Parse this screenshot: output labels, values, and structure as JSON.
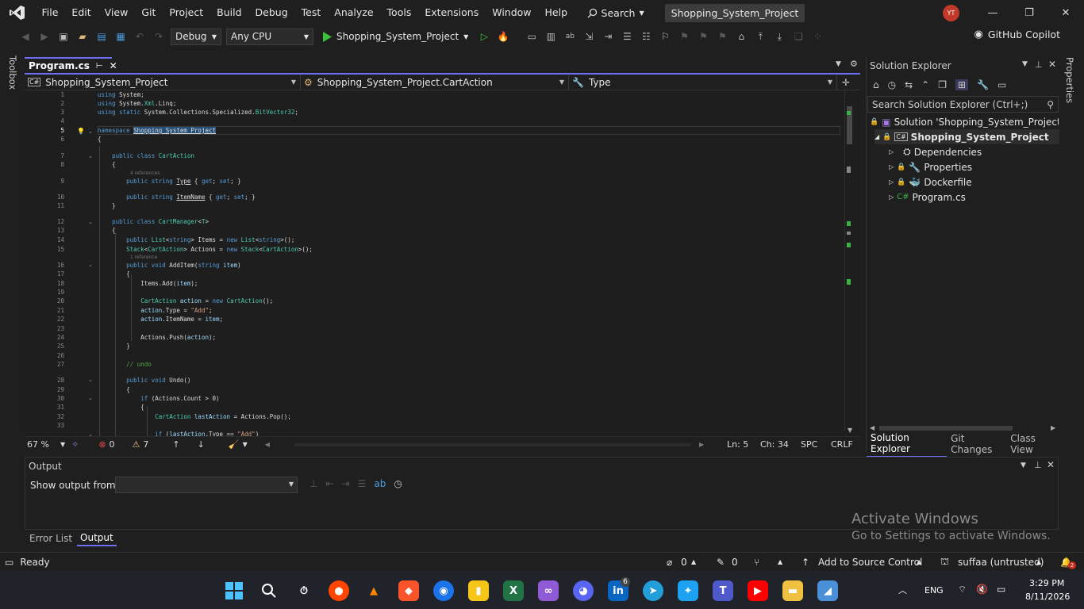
{
  "menubar": {
    "items": [
      "File",
      "Edit",
      "View",
      "Git",
      "Project",
      "Build",
      "Debug",
      "Test",
      "Analyze",
      "Tools",
      "Extensions",
      "Window",
      "Help"
    ],
    "search_label": "Search",
    "project_title": "Shopping_System_Project",
    "avatar_initials": "YT"
  },
  "toolbar": {
    "configuration": "Debug",
    "platform": "Any CPU",
    "run_target": "Shopping_System_Project",
    "copilot_label": "GitHub Copilot"
  },
  "side": {
    "toolbox": "Toolbox",
    "properties": "Properties"
  },
  "document": {
    "tab_name": "Program.cs",
    "nav_project": "Shopping_System_Project",
    "nav_class": "Shopping_System_Project.CartAction",
    "nav_member": "Type"
  },
  "editor": {
    "line_numbers": [
      "1",
      "2",
      "3",
      "4",
      "5",
      "6",
      "7",
      "8",
      "9",
      "10",
      "11",
      "12",
      "13",
      "14",
      "15",
      "16",
      "17",
      "18",
      "19",
      "20",
      "21",
      "22",
      "23",
      "24",
      "25",
      "26",
      "27",
      "28",
      "29",
      "30",
      "31",
      "32",
      "33"
    ],
    "references_4": "4 references",
    "references_1": "1 reference"
  },
  "editor_status": {
    "zoom": "67 %",
    "errors": "0",
    "warnings": "7",
    "line": "Ln: 5",
    "col": "Ch: 34",
    "whitespace": "SPC",
    "line_endings": "CRLF"
  },
  "solution_explorer": {
    "title": "Solution Explorer",
    "search_placeholder": "Search Solution Explorer (Ctrl+;)",
    "solution": "Solution 'Shopping_System_Project' (1 o",
    "project": "Shopping_System_Project",
    "items": [
      "Dependencies",
      "Properties",
      "Dockerfile",
      "Program.cs"
    ],
    "tabs": [
      "Solution Explorer",
      "Git Changes",
      "Class View"
    ]
  },
  "output": {
    "title": "Output",
    "show_from": "Show output from:"
  },
  "bottom_tabs": [
    "Error List",
    "Output"
  ],
  "statusbar": {
    "ready": "Ready",
    "up_count": "0",
    "pencil_count": "0",
    "source_control": "Add to Source Control",
    "repo": "suffaa (untrusted)",
    "notif": "2"
  },
  "watermark": {
    "line1": "Activate Windows",
    "line2": "Go to Settings to activate Windows."
  },
  "taskbar": {
    "lang": "ENG",
    "time": "3:29 PM",
    "date": "8/11/2026",
    "linkedin_badge": "6"
  },
  "colors": {
    "accent": "#6e6ef2",
    "background": "#1f1f1f",
    "editor": "#1e1e1e",
    "keyword": "#569cd6",
    "type": "#4ec9b0",
    "comment": "#57a64a",
    "string": "#d69d85"
  }
}
